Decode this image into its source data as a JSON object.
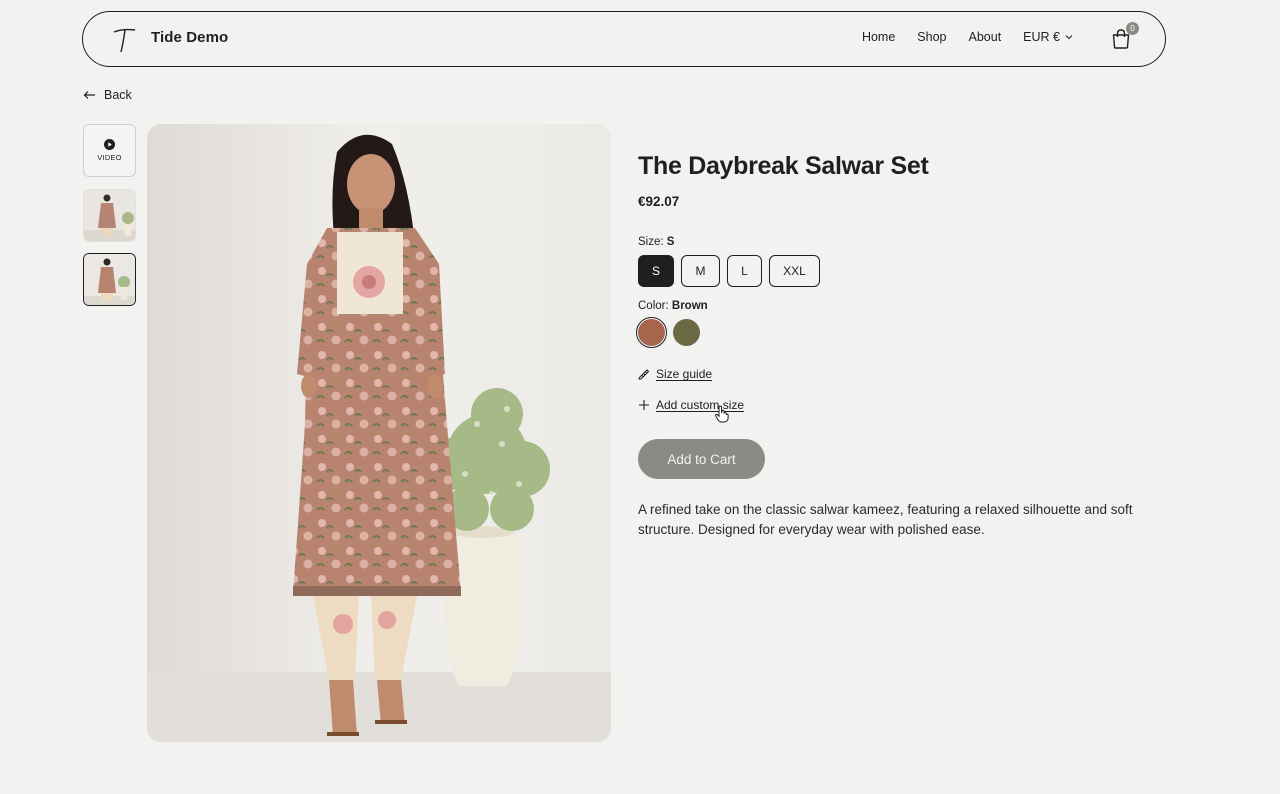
{
  "header": {
    "brand": "Tide Demo",
    "nav": [
      "Home",
      "Shop",
      "About"
    ],
    "currency": "EUR €",
    "cart_count": "0"
  },
  "back_label": "Back",
  "thumbnails": {
    "video_label": "VIDEO"
  },
  "product": {
    "title": "The Daybreak Salwar Set",
    "price": "€92.07",
    "size_label": "Size:",
    "selected_size": "S",
    "sizes": [
      "S",
      "M",
      "L",
      "XXL"
    ],
    "color_label": "Color:",
    "selected_color": "Brown",
    "colors": [
      "#a8654d",
      "#6b6a45"
    ],
    "size_guide": "Size guide",
    "custom_size": "Add custom size",
    "add_to_cart": "Add to Cart",
    "description": "A refined take on the classic salwar kameez, featuring a relaxed silhouette and soft structure. Designed for everyday wear with polished ease."
  }
}
